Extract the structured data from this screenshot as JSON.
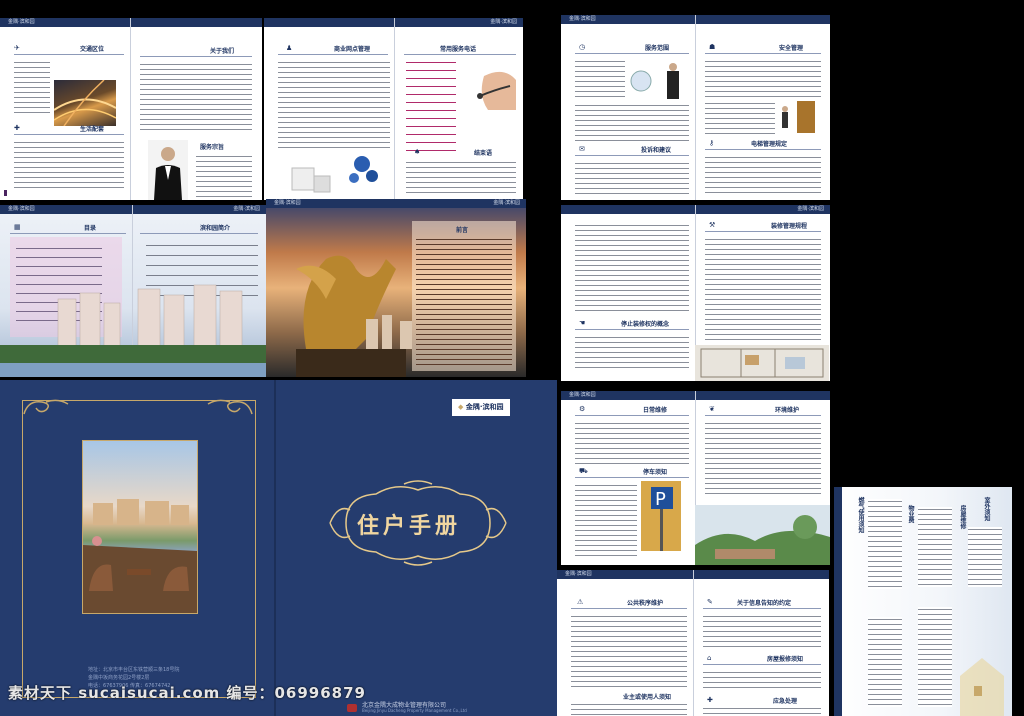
{
  "brand": "金隅·滨和园",
  "brand_short": "金隅·滨和园",
  "page1": {
    "left_title": "交通区位",
    "left_title2": "生活配套",
    "right_title": "关于我们",
    "right_title2": "服务宗旨"
  },
  "page2": {
    "left_title": "商业网点管理",
    "right_title": "常用服务电话",
    "right_title2": "结束语"
  },
  "page3": {
    "left_title": "服务范围",
    "left_title2": "投诉和建议",
    "right_title": "安全管理",
    "right_title2": "电梯管理规定"
  },
  "page4": {
    "left_title": "目录",
    "right_title": "滨和园简介"
  },
  "page5": {
    "right_title": "前言"
  },
  "page6": {
    "right_title": "装修管理规程",
    "left_title2": "停止装修权的概念"
  },
  "page7": {
    "left_title": "日常维修",
    "left_title2": "停车须知",
    "right_title": "环境维护"
  },
  "page8": {
    "left_title": "公共秩序维护",
    "right_title": "关于信息告知的约定",
    "right_title2": "房屋报修须知",
    "left_title3": "业主或使用人须知",
    "right_title3": "应急处理"
  },
  "page9": {
    "v1": "燃气使用须知",
    "v2": "物业费",
    "v3": "房屋维修",
    "v4": "室外须知"
  },
  "cover": {
    "title": "住户手册",
    "logo": "金隅·滨和园",
    "company": "北京金隅大成物业管理有限公司",
    "company_en": "Beijing Jinyu Dacheng Property Management Co.,Ltd",
    "addr1": "地址：北京市丰台区东铁营顺三条18号院",
    "addr2": "金隅中坂商务花园2号楼2层",
    "addr3": "电话：67637906   传真：67674742"
  },
  "watermark": "素材天下 sucaisucai.com  编号：06996879",
  "colors": {
    "navy": "#1f3461",
    "cover": "#253c6e",
    "gold": "#c7a86a",
    "accent": "#4a2460"
  }
}
